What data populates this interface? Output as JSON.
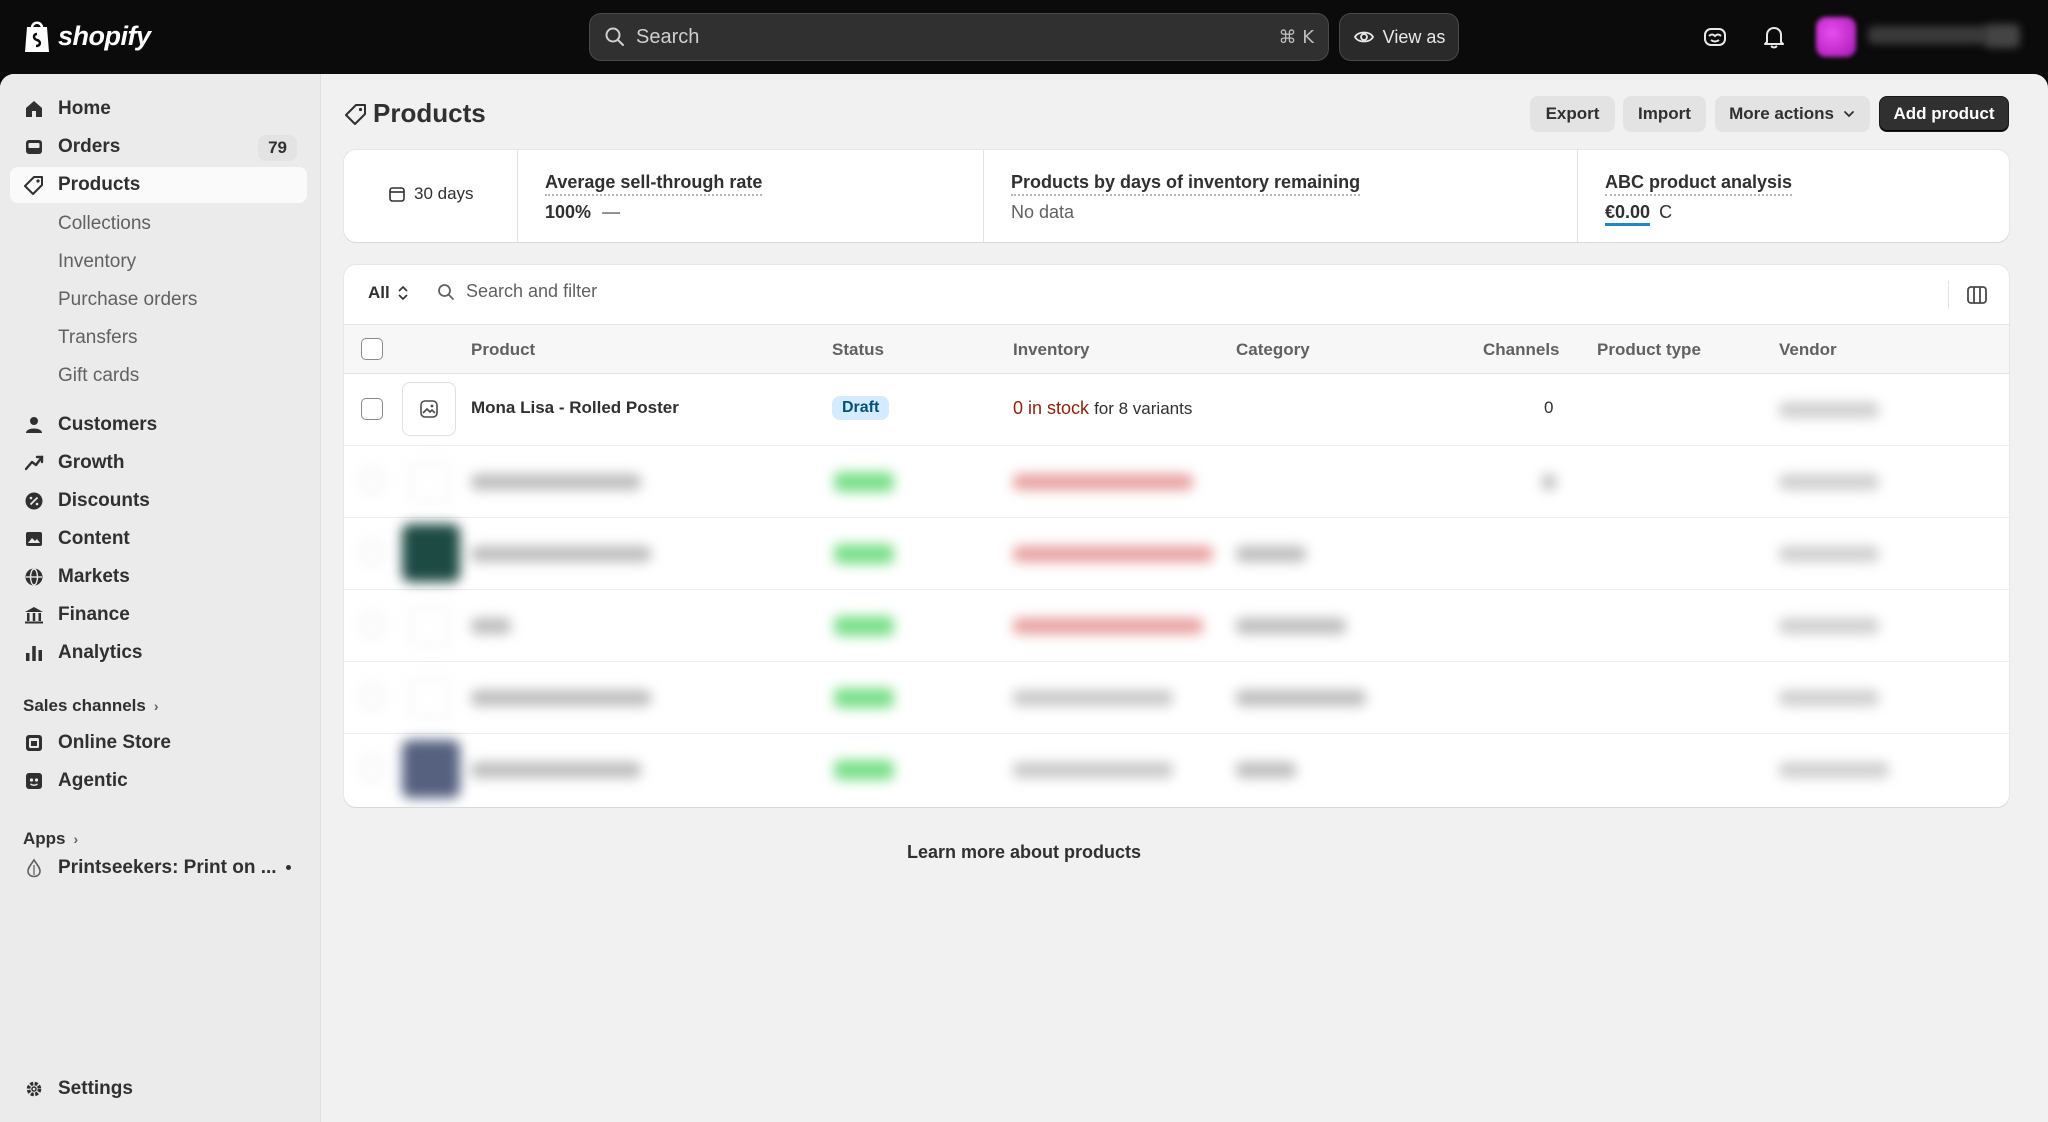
{
  "topbar": {
    "brand": "shopify",
    "search_placeholder": "Search",
    "search_shortcut": "⌘  K",
    "view_as_label": "View as"
  },
  "sidebar": {
    "items": [
      {
        "label": "Home",
        "icon": "home-icon"
      },
      {
        "label": "Orders",
        "icon": "orders-icon",
        "badge": "79"
      },
      {
        "label": "Products",
        "icon": "tag-icon",
        "active": true
      },
      {
        "label": "Customers",
        "icon": "person-icon"
      },
      {
        "label": "Growth",
        "icon": "growth-icon"
      },
      {
        "label": "Discounts",
        "icon": "discount-icon"
      },
      {
        "label": "Content",
        "icon": "content-icon"
      },
      {
        "label": "Markets",
        "icon": "globe-icon"
      },
      {
        "label": "Finance",
        "icon": "bank-icon"
      },
      {
        "label": "Analytics",
        "icon": "chart-icon"
      }
    ],
    "product_subitems": [
      "Collections",
      "Inventory",
      "Purchase orders",
      "Transfers",
      "Gift cards"
    ],
    "sales_channels_label": "Sales channels",
    "channels": [
      {
        "label": "Online Store",
        "icon": "store-icon"
      },
      {
        "label": "Agentic",
        "icon": "agent-icon"
      }
    ],
    "apps_label": "Apps",
    "app": {
      "label": "Printseekers: Print on ...",
      "icon": "drop-icon"
    },
    "settings_label": "Settings"
  },
  "page": {
    "title": "Products",
    "buttons": {
      "export": "Export",
      "import": "Import",
      "more_actions": "More actions",
      "add_product": "Add product"
    }
  },
  "stats": {
    "period": "30 days",
    "sell_through": {
      "title": "Average sell-through rate",
      "value": "100%",
      "trend": "—"
    },
    "days_remaining": {
      "title": "Products by days of inventory remaining",
      "value": "No data"
    },
    "abc": {
      "title": "ABC product analysis",
      "value": "€0.00",
      "grade": "C"
    }
  },
  "table": {
    "filter_tab": "All",
    "search_placeholder": "Search and filter",
    "columns": [
      "Product",
      "Status",
      "Inventory",
      "Category",
      "Channels",
      "Product type",
      "Vendor"
    ],
    "rows": [
      {
        "product": "Mona Lisa - Rolled Poster",
        "status": "Draft",
        "inventory_stock": "0 in stock",
        "inventory_rest": "for 8 variants",
        "category": "",
        "channels": "0",
        "product_type": "",
        "vendor": ""
      }
    ],
    "blurred_row_count": 5
  },
  "footer_link": "Learn more about products",
  "colors": {
    "topbar": "#0b0b0b",
    "page_bg": "#f1f1f1",
    "primary_button": "#303030",
    "draft_badge_bg": "#d5ebff",
    "stock_red": "#8e1f0b",
    "active_badge_green": "#7be08a"
  }
}
